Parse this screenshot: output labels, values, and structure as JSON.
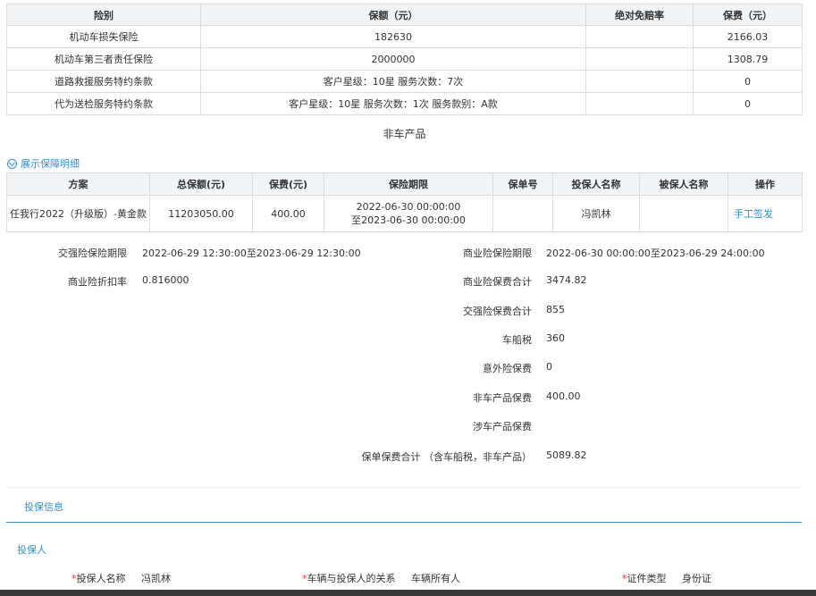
{
  "coverage_table": {
    "headers": [
      "险别",
      "保额（元）",
      "绝对免赔率",
      "保费（元）"
    ],
    "rows": [
      [
        "机动车损失保险",
        "182630",
        "",
        "2166.03"
      ],
      [
        "机动车第三者责任保险",
        "2000000",
        "",
        "1308.79"
      ],
      [
        "道路救援服务特约条款",
        "客户星级：10星 服务次数：7次",
        "",
        "0"
      ],
      [
        "代为送检服务特约条款",
        "客户星级：10星 服务次数：1次 服务款别：A款",
        "",
        "0"
      ]
    ]
  },
  "non_vehicle": {
    "title": "非车产品",
    "expand_label": "展示保障明细"
  },
  "product_table": {
    "headers": [
      "方案",
      "总保额(元)",
      "保费(元)",
      "保险期限",
      "保单号",
      "投保人名称",
      "被保人名称",
      "操作"
    ],
    "rows": [
      {
        "plan": "任我行2022（升级版）-黄金款",
        "total_amount": "11203050.00",
        "premium": "400.00",
        "period_start": "2022-06-30 00:00:00",
        "period_end": "至2023-06-30 00:00:00",
        "policy_no": "",
        "applicant": "冯凯林",
        "insured": "",
        "action": "手工签发"
      }
    ]
  },
  "summary_left": [
    {
      "label": "交强险保险期限",
      "value": "2022-06-29 12:30:00至2023-06-29 12:30:00"
    },
    {
      "label": "商业险折扣率",
      "value": "0.816000"
    }
  ],
  "summary_right": [
    {
      "label": "商业险保险期限",
      "value": "2022-06-30 00:00:00至2023-06-29 24:00:00"
    },
    {
      "label": "商业险保费合计",
      "value": "3474.82"
    },
    {
      "label": "交强险保费合计",
      "value": "855"
    },
    {
      "label": "车船税",
      "value": "360"
    },
    {
      "label": "意外险保费",
      "value": "0"
    },
    {
      "label": "非车产品保费",
      "value": "400.00"
    },
    {
      "label": "涉车产品保费",
      "value": ""
    },
    {
      "label": "保单保费合计 （含车船税，非车产品）",
      "value": "5089.82"
    }
  ],
  "info_section": {
    "tab_label": "投保信息",
    "applicant_heading": "投保人",
    "fields": [
      {
        "required": "*",
        "label": "投保人名称",
        "value": "冯凯林"
      },
      {
        "required": "*",
        "label": "车辆与投保人的关系",
        "value": "车辆所有人"
      },
      {
        "required": "*",
        "label": "证件类型",
        "value": "身份证"
      }
    ]
  },
  "colors": {
    "accent": "#2f8fd6",
    "header_bg": "#f1f4f7",
    "border": "#dcdcdc",
    "required": "#e33333"
  }
}
